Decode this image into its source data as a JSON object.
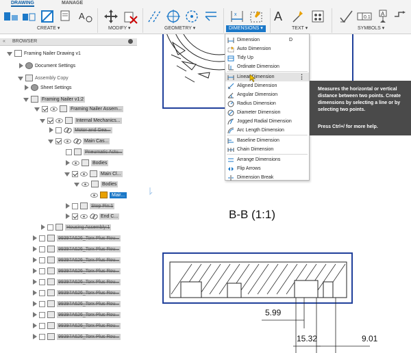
{
  "ribbon": {
    "tabs": [
      "DRAWING",
      "MANAGE"
    ],
    "groups": [
      "CREATE ▾",
      "MODIFY ▾",
      "GEOMETRY ▾",
      "DIMENSIONS ▾",
      "TEXT ▾",
      "SYMBOLS ▾"
    ],
    "text_icon_glyph": "A",
    "accent": "#1b78c8"
  },
  "browser": {
    "title": "BROWSER",
    "nodes": [
      {
        "label": "Framing Nailer Drawing v1"
      },
      {
        "label": "Document Settings"
      },
      {
        "label": "Assembly Copy"
      },
      {
        "label": "Sheet Settings"
      },
      {
        "label": "Framing Nailer v1:2"
      },
      {
        "label": "Framing Nailer Assem..."
      },
      {
        "label": "Internal Mechanics..."
      },
      {
        "label": "Motor and Gea..."
      },
      {
        "label": "Main Cas..."
      },
      {
        "label": "Pneumatic Actu..."
      },
      {
        "label": "Bodies"
      },
      {
        "label": "Main Cl..."
      },
      {
        "label": "Bodies"
      },
      {
        "label": "Mair..."
      },
      {
        "label": "Stop Pin:1"
      },
      {
        "label": "End C..."
      },
      {
        "label": "Housing Assembly:1"
      },
      {
        "label": "99397A626_Torx Plus Rou..."
      },
      {
        "label": "99397A626_Torx Plus Rou..."
      },
      {
        "label": "99397A626_Torx Plus Rou..."
      },
      {
        "label": "99397A626_Torx Plus Rou..."
      },
      {
        "label": "99397A626_Torx Plus Rou..."
      },
      {
        "label": "99397A626_Torx Plus Rou..."
      },
      {
        "label": "99397A626_Torx Plus Rou..."
      },
      {
        "label": "99397A626_Torx Plus Rou..."
      },
      {
        "label": "99397A626_Torx Plus Rou..."
      },
      {
        "label": "99397A626_Torx Plus Rou..."
      }
    ]
  },
  "dimensions_menu": {
    "items": [
      {
        "label": "Dimension",
        "shortcut": "D"
      },
      {
        "label": "Auto Dimension"
      },
      {
        "label": "Tidy Up"
      },
      {
        "label": "Ordinate Dimension"
      },
      {
        "label": "Linear Dimension",
        "more": "⋮"
      },
      {
        "label": "Aligned Dimension"
      },
      {
        "label": "Angular Dimension"
      },
      {
        "label": "Radius Dimension"
      },
      {
        "label": "Diameter Dimension"
      },
      {
        "label": "Jogged Radial Dimension"
      },
      {
        "label": "Arc Length Dimension"
      },
      {
        "label": "Baseline Dimension"
      },
      {
        "label": "Chain Dimension"
      },
      {
        "label": "Arrange Dimensions"
      },
      {
        "label": "Flip Arrows"
      },
      {
        "label": "Dimension Break"
      }
    ]
  },
  "tooltip": {
    "text": "Measures the horizontal or vertical distance between two points. Create dimensions by selecting a line or by selecting two points.",
    "hint": "Press Ctrl+/ for more help."
  },
  "drawing": {
    "section_title": "B-B (1:1)",
    "dims": [
      "5.99",
      "15.32",
      "9.01"
    ]
  }
}
